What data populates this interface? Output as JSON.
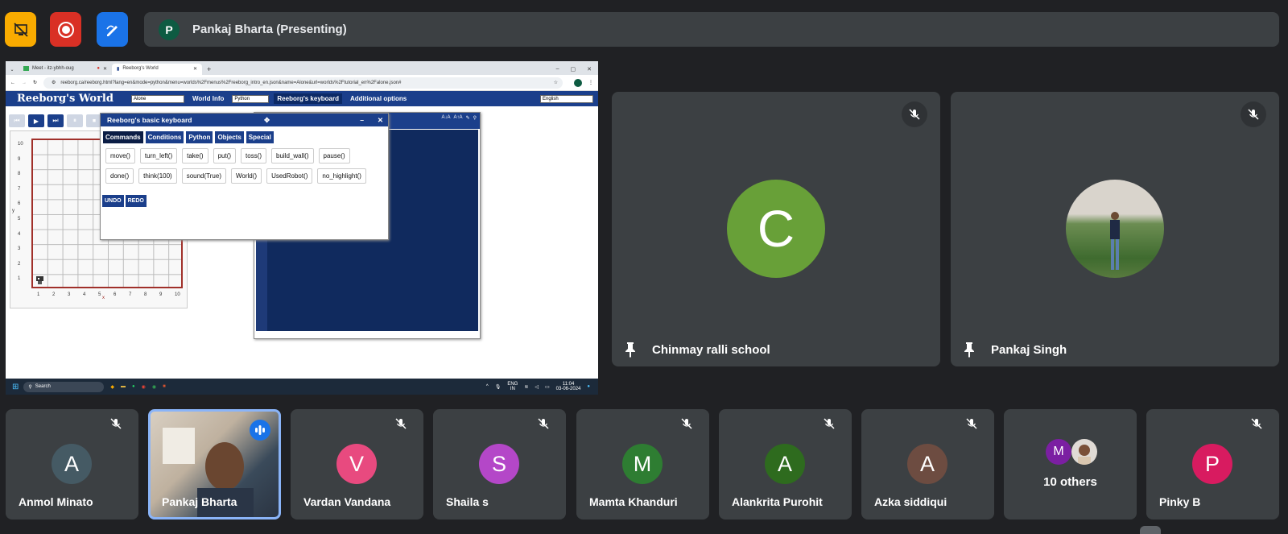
{
  "topbar": {
    "presenter_initial": "P",
    "presenter_label": "Pankaj Bharta (Presenting)"
  },
  "shared_screen": {
    "tabs": [
      {
        "label": "Meet - itz-ybhh-oug"
      },
      {
        "label": "Reeborg's World"
      }
    ],
    "url": "reeborg.ca/reeborg.html?lang=en&mode=python&menu=worlds%2Fmenus%2Freeborg_intro_en.json&name=Alone&url=worlds%2Ftutorial_en%2Falone.json#",
    "app_title": "Reeborg's World",
    "world_select": "Alone",
    "menu": {
      "world_info": "World Info",
      "language_select": "Python",
      "keyboard": "Reeborg's keyboard",
      "additional": "Additional options",
      "ui_language": "English"
    },
    "grid": {
      "y_labels": [
        "10",
        "9",
        "8",
        "7",
        "6",
        "5",
        "4",
        "3",
        "2",
        "1"
      ],
      "x_labels": [
        "1",
        "2",
        "3",
        "4",
        "5",
        "6",
        "7",
        "8",
        "9",
        "10"
      ],
      "x_axis": "x",
      "y_axis": "y"
    },
    "keyboard": {
      "title": "Reeborg's basic keyboard",
      "tabs": [
        "Commands",
        "Conditions",
        "Python",
        "Objects",
        "Special"
      ],
      "row1": [
        "move()",
        "turn_left()",
        "take()",
        "put()",
        "toss()",
        "build_wall()",
        "pause()"
      ],
      "row2": [
        "done()",
        "think(100)",
        "sound(True)",
        "World()",
        "UsedRobot()",
        "no_highlight()"
      ],
      "undo": "UNDO",
      "redo": "REDO"
    },
    "taskbar": {
      "search": "Search",
      "lang": "ENG",
      "region": "IN",
      "time": "11:04",
      "date": "03-06-2024"
    }
  },
  "tiles": [
    {
      "initial": "C",
      "name": "Chinmay ralli school",
      "color": "#68a038"
    },
    {
      "initial": "",
      "name": "Pankaj Singh",
      "color": "#6b8a5a"
    }
  ],
  "participants": [
    {
      "initial": "A",
      "name": "Anmol Minato",
      "color": "#455a64"
    },
    {
      "initial": "",
      "name": "Pankaj Bharta",
      "color": "#8a6a4a"
    },
    {
      "initial": "V",
      "name": "Vardan Vandana",
      "color": "#e84a7f"
    },
    {
      "initial": "S",
      "name": "Shaila s",
      "color": "#b447c8"
    },
    {
      "initial": "M",
      "name": "Mamta Khanduri",
      "color": "#2e7d32"
    },
    {
      "initial": "A",
      "name": "Alankrita Purohit",
      "color": "#2e6b1e"
    },
    {
      "initial": "A",
      "name": "Azka siddiqui",
      "color": "#6d4c41"
    },
    {
      "initial": "M",
      "name": "10 others",
      "color": "#7b1fa2"
    },
    {
      "initial": "P",
      "name": "Pinky B",
      "color": "#d81b60"
    }
  ]
}
